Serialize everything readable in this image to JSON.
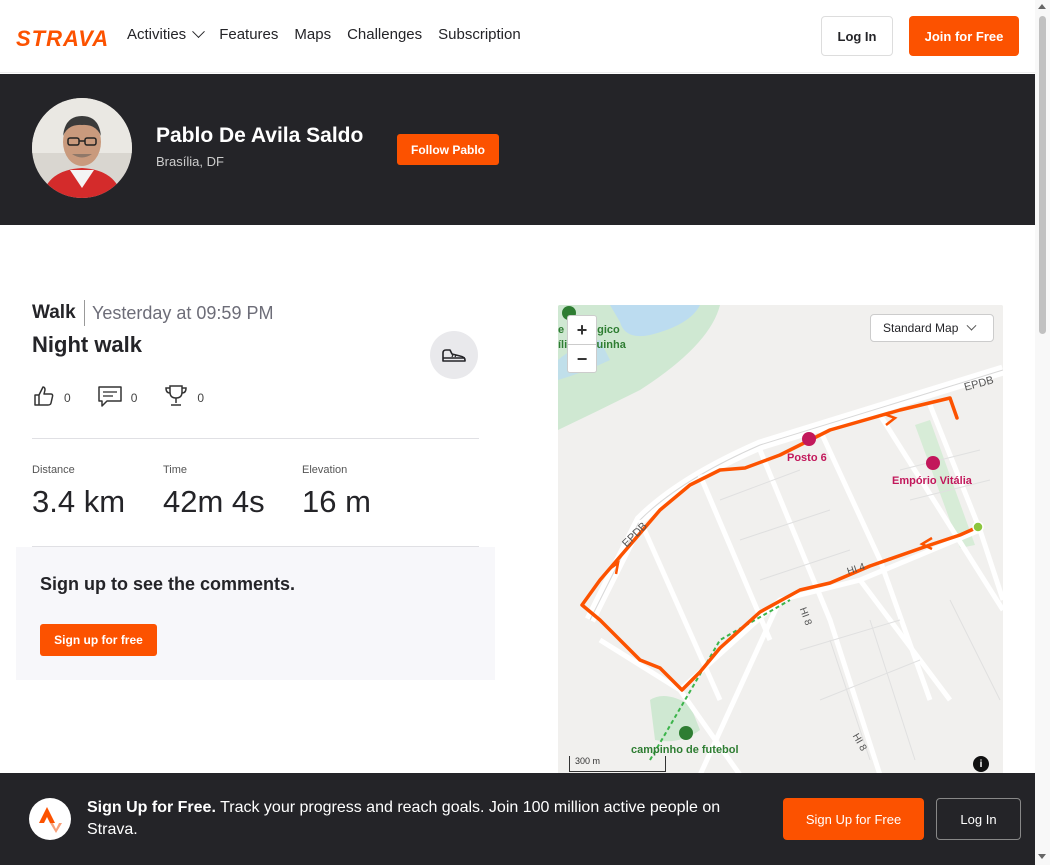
{
  "header": {
    "logo": "STRAVA",
    "nav": [
      "Activities",
      "Features",
      "Maps",
      "Challenges",
      "Subscription"
    ],
    "login_label": "Log In",
    "join_label": "Join for Free"
  },
  "athlete": {
    "name": "Pablo De Avila Saldo",
    "location": "Brasília, DF",
    "follow_label": "Follow Pablo"
  },
  "activity": {
    "type": "Walk",
    "date": "Yesterday at 09:59 PM",
    "title": "Night walk",
    "kudos": "0",
    "comments": "0",
    "achievements": "0",
    "stats": [
      {
        "label": "Distance",
        "value": "3.4 km"
      },
      {
        "label": "Time",
        "value": "42m 4s"
      },
      {
        "label": "Elevation",
        "value": "16 m"
      }
    ]
  },
  "comments_prompt": {
    "heading": "Sign up to see the comments.",
    "button": "Sign up for free"
  },
  "map": {
    "style_selector": "Standard Map",
    "scale_label": "300 m",
    "labels": {
      "posto": "Posto 6",
      "emporio": "Empório Vitália",
      "campinho": "campinho de futebol",
      "epdb1": "EPDB",
      "epdb2": "EPDB",
      "hi4": "HI 4",
      "hi8a": "HI 8",
      "hi8b": "HI 8",
      "park1": "e Ecológico",
      "park2": "ília Saquinha"
    },
    "route_color": "#fc5200"
  },
  "cta": {
    "bold": "Sign Up for Free.",
    "text": "Track your progress and reach goals. Join 100 million active people on Strava.",
    "signup_label": "Sign Up for Free",
    "login_label": "Log In"
  },
  "colors": {
    "brand": "#fc5200",
    "dark": "#242428"
  }
}
